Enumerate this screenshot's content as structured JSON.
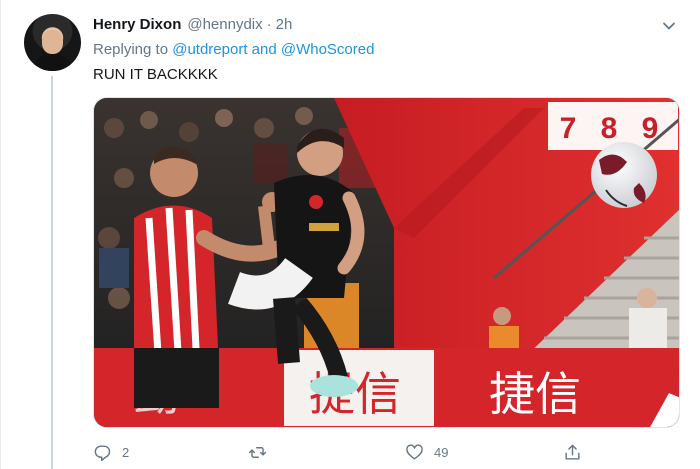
{
  "tweet": {
    "display_name": "Henry Dixon",
    "handle": "@hennydix",
    "separator": "·",
    "time": "2h",
    "replying_prefix": "Replying to",
    "mention_1": "@utdreport",
    "replying_and": "and",
    "mention_2": "@WhoScored",
    "text": "RUN IT BACKKKK"
  },
  "media": {
    "scoreboard_digits": [
      "7",
      "8",
      "9"
    ],
    "banner_text_1": "勐",
    "banner_text_2": "提信",
    "banner_text_3": "捷信"
  },
  "actions": {
    "reply_count": "2",
    "retweet_count": "",
    "like_count": "49"
  },
  "icons": {
    "caret": "chevron-down-icon",
    "reply": "reply-icon",
    "retweet": "retweet-icon",
    "like": "heart-icon",
    "share": "share-icon"
  },
  "colors": {
    "link": "#1b95e0",
    "secondary_text": "#657786",
    "stadium_red": "#d3252a"
  }
}
